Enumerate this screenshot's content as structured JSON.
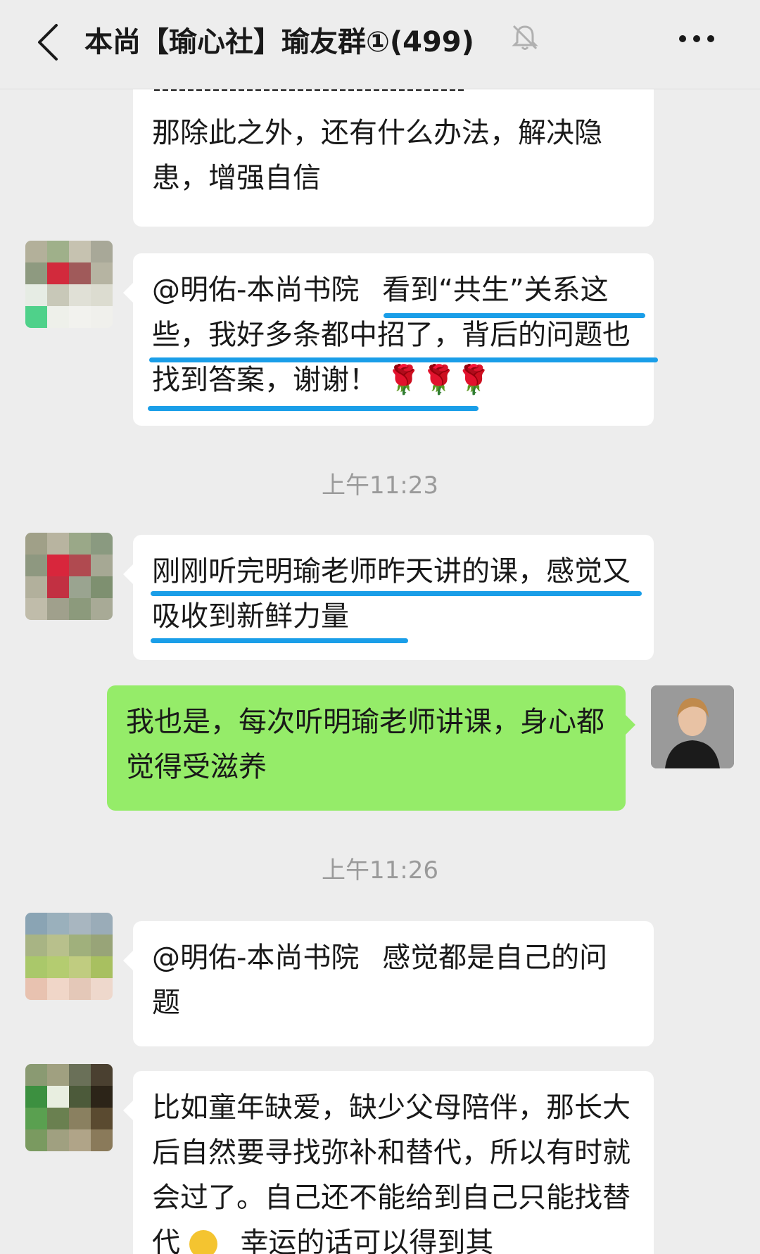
{
  "header": {
    "title": "本尚【瑜心社】瑜友群①(499)"
  },
  "messages": [
    {
      "text": "那除此之外，还有什么办法，解决隐患，增强自信"
    },
    {
      "mention": "@明佑-本尚书院",
      "text": "看到“共生”关系这些，我好多条都中招了，背后的问题也找到答案，谢谢！",
      "emoji": "🌹🌹🌹"
    },
    {
      "text": "刚刚听完明瑜老师昨天讲的课，感觉又吸收到新鲜力量"
    },
    {
      "text": "我也是，每次听明瑜老师讲课，身心都觉得受滋养"
    },
    {
      "mention": "@明佑-本尚书院",
      "text": "感觉都是自己的问题"
    },
    {
      "text": "比如童年缺爱，缺少父母陪伴，那长大后自然要寻找弥补和替代，所以有时就会过了。自己还不能给到自己只能找替代",
      "tail": "幸运的话可以得到其"
    }
  ],
  "timestamps": [
    "上午11:23",
    "上午11:26"
  ],
  "colors": {
    "accent_underline": "#1a9ee8",
    "self_bubble": "#95ec69",
    "background": "#ededed"
  },
  "icons": [
    "back-arrow-icon",
    "mute-bell-icon",
    "more-icon",
    "rose-icon"
  ]
}
